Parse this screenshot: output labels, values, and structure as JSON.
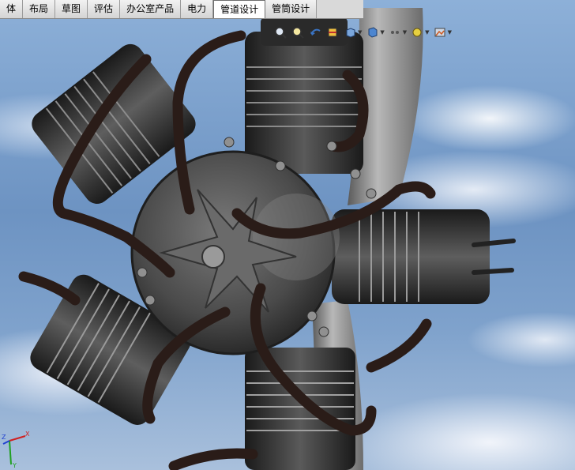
{
  "tabs": [
    {
      "label": "体",
      "active": false
    },
    {
      "label": "布局",
      "active": false
    },
    {
      "label": "草图",
      "active": false
    },
    {
      "label": "评估",
      "active": false
    },
    {
      "label": "办公室产品",
      "active": false
    },
    {
      "label": "电力",
      "active": false
    },
    {
      "label": "管道设计",
      "active": true
    },
    {
      "label": "管筒设计",
      "active": false
    }
  ],
  "toolbar": {
    "icons": [
      "zoom-to-fit-icon",
      "zoom-area-icon",
      "previous-view-icon",
      "section-view-icon",
      "view-orientation-icon",
      "display-style-icon",
      "hide-show-icon",
      "edit-appearance-icon",
      "scene-icon",
      "view-settings-icon"
    ]
  },
  "triad": {
    "x_label": "X",
    "y_label": "Y",
    "z_label": "Z"
  },
  "colors": {
    "tab_active_bg": "#ffffff",
    "tab_bg": "#d9d9d9",
    "accent": "#3a74c4"
  }
}
